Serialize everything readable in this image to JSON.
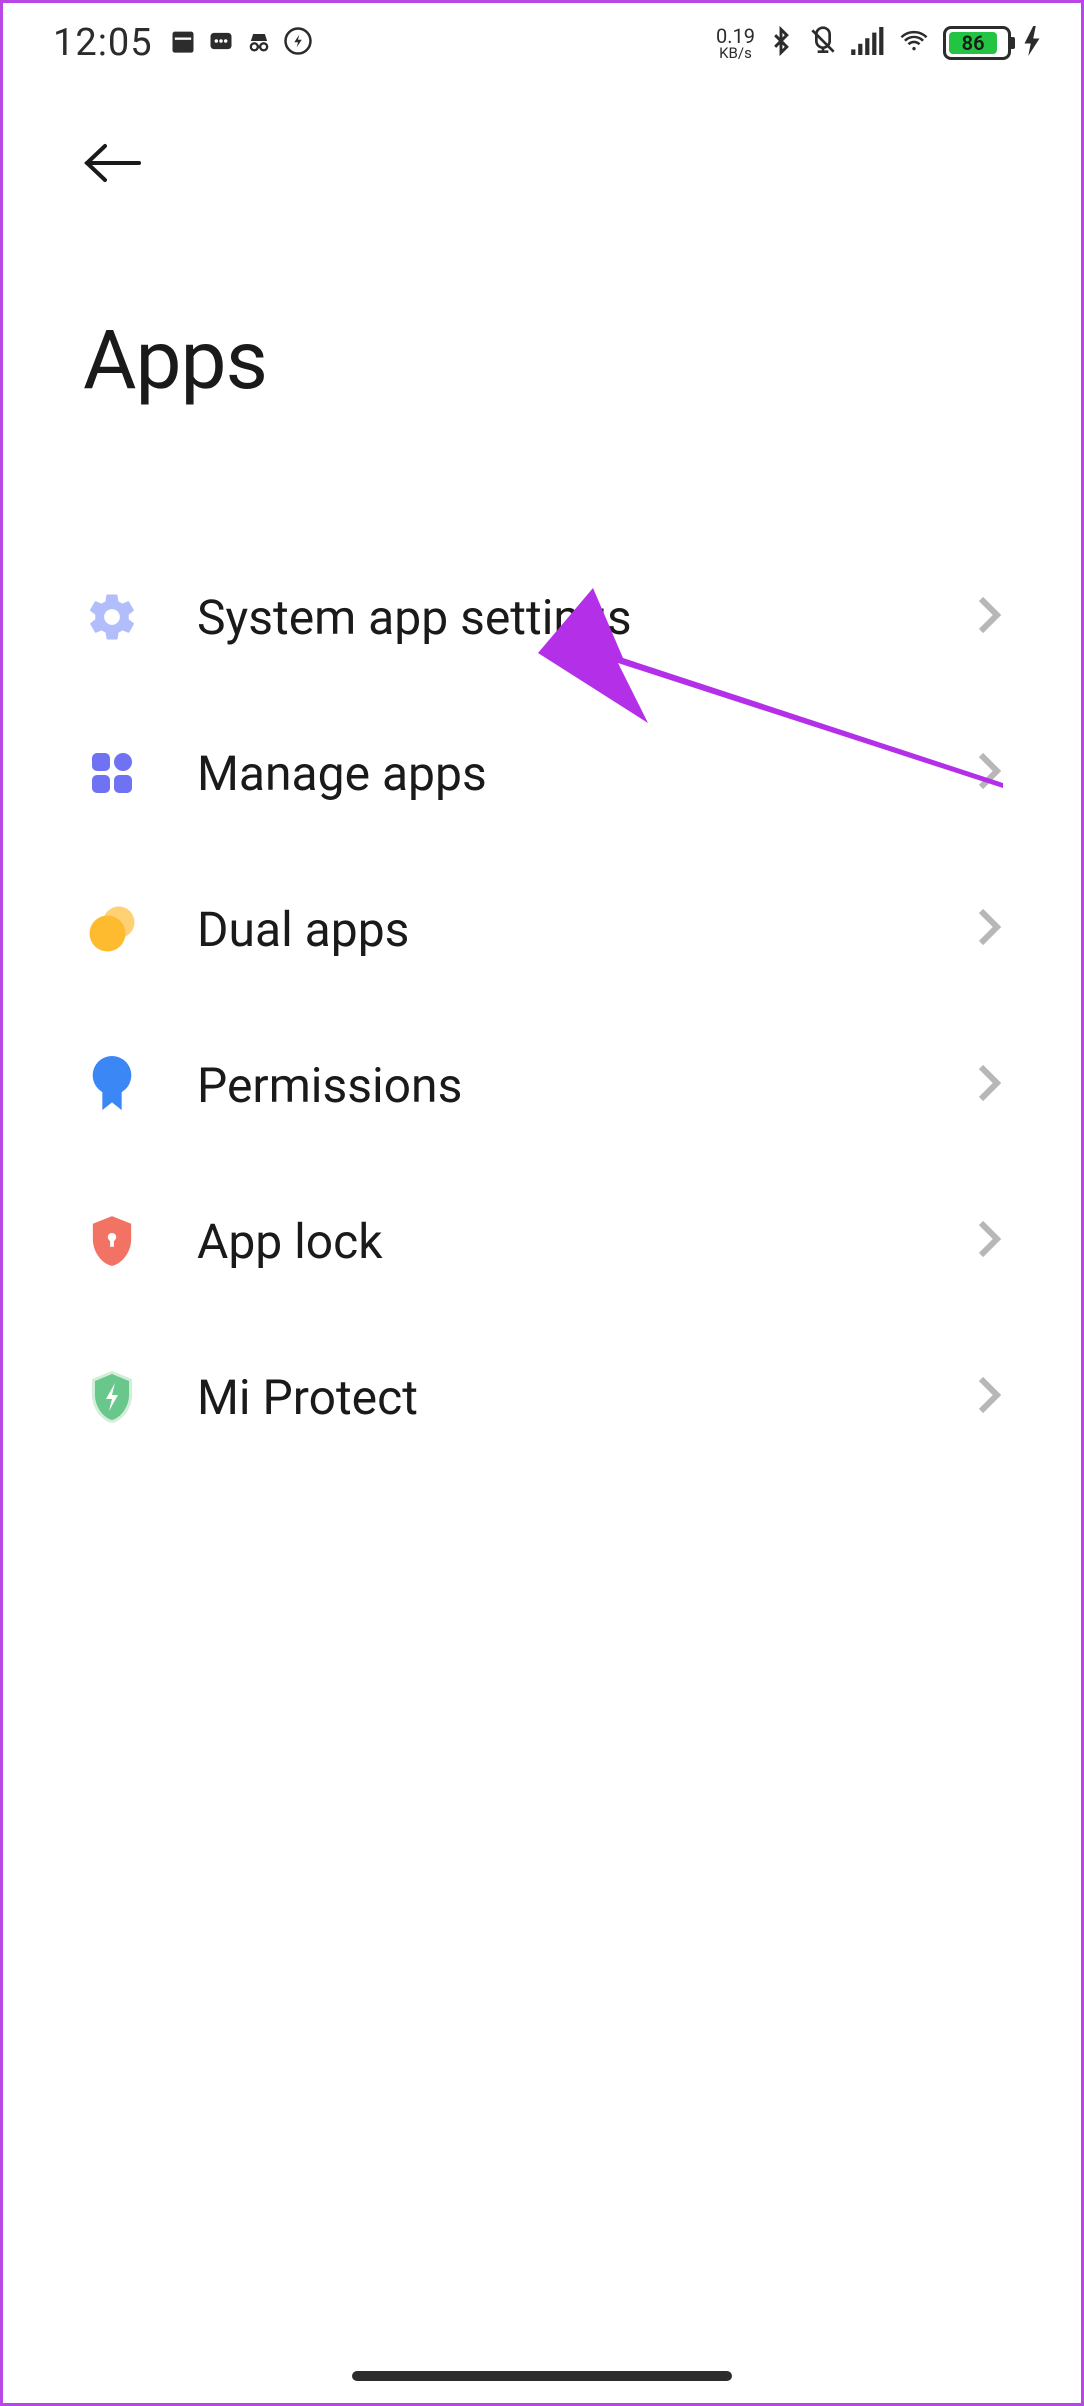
{
  "status": {
    "time": "12:05",
    "speed_value": "0.19",
    "speed_unit": "KB/s",
    "battery_percent": "86"
  },
  "page": {
    "title": "Apps"
  },
  "list": [
    {
      "label": "System app settings",
      "icon": "gear",
      "color": "#b2befb"
    },
    {
      "label": "Manage apps",
      "icon": "grid",
      "color": "#6f72f2"
    },
    {
      "label": "Dual apps",
      "icon": "dual",
      "color": "#ffbb2f"
    },
    {
      "label": "Permissions",
      "icon": "badge",
      "color": "#3c87f6"
    },
    {
      "label": "App lock",
      "icon": "shield-lock",
      "color": "#f27263"
    },
    {
      "label": "Mi Protect",
      "icon": "shield-bolt",
      "color": "#6ac78b"
    }
  ]
}
